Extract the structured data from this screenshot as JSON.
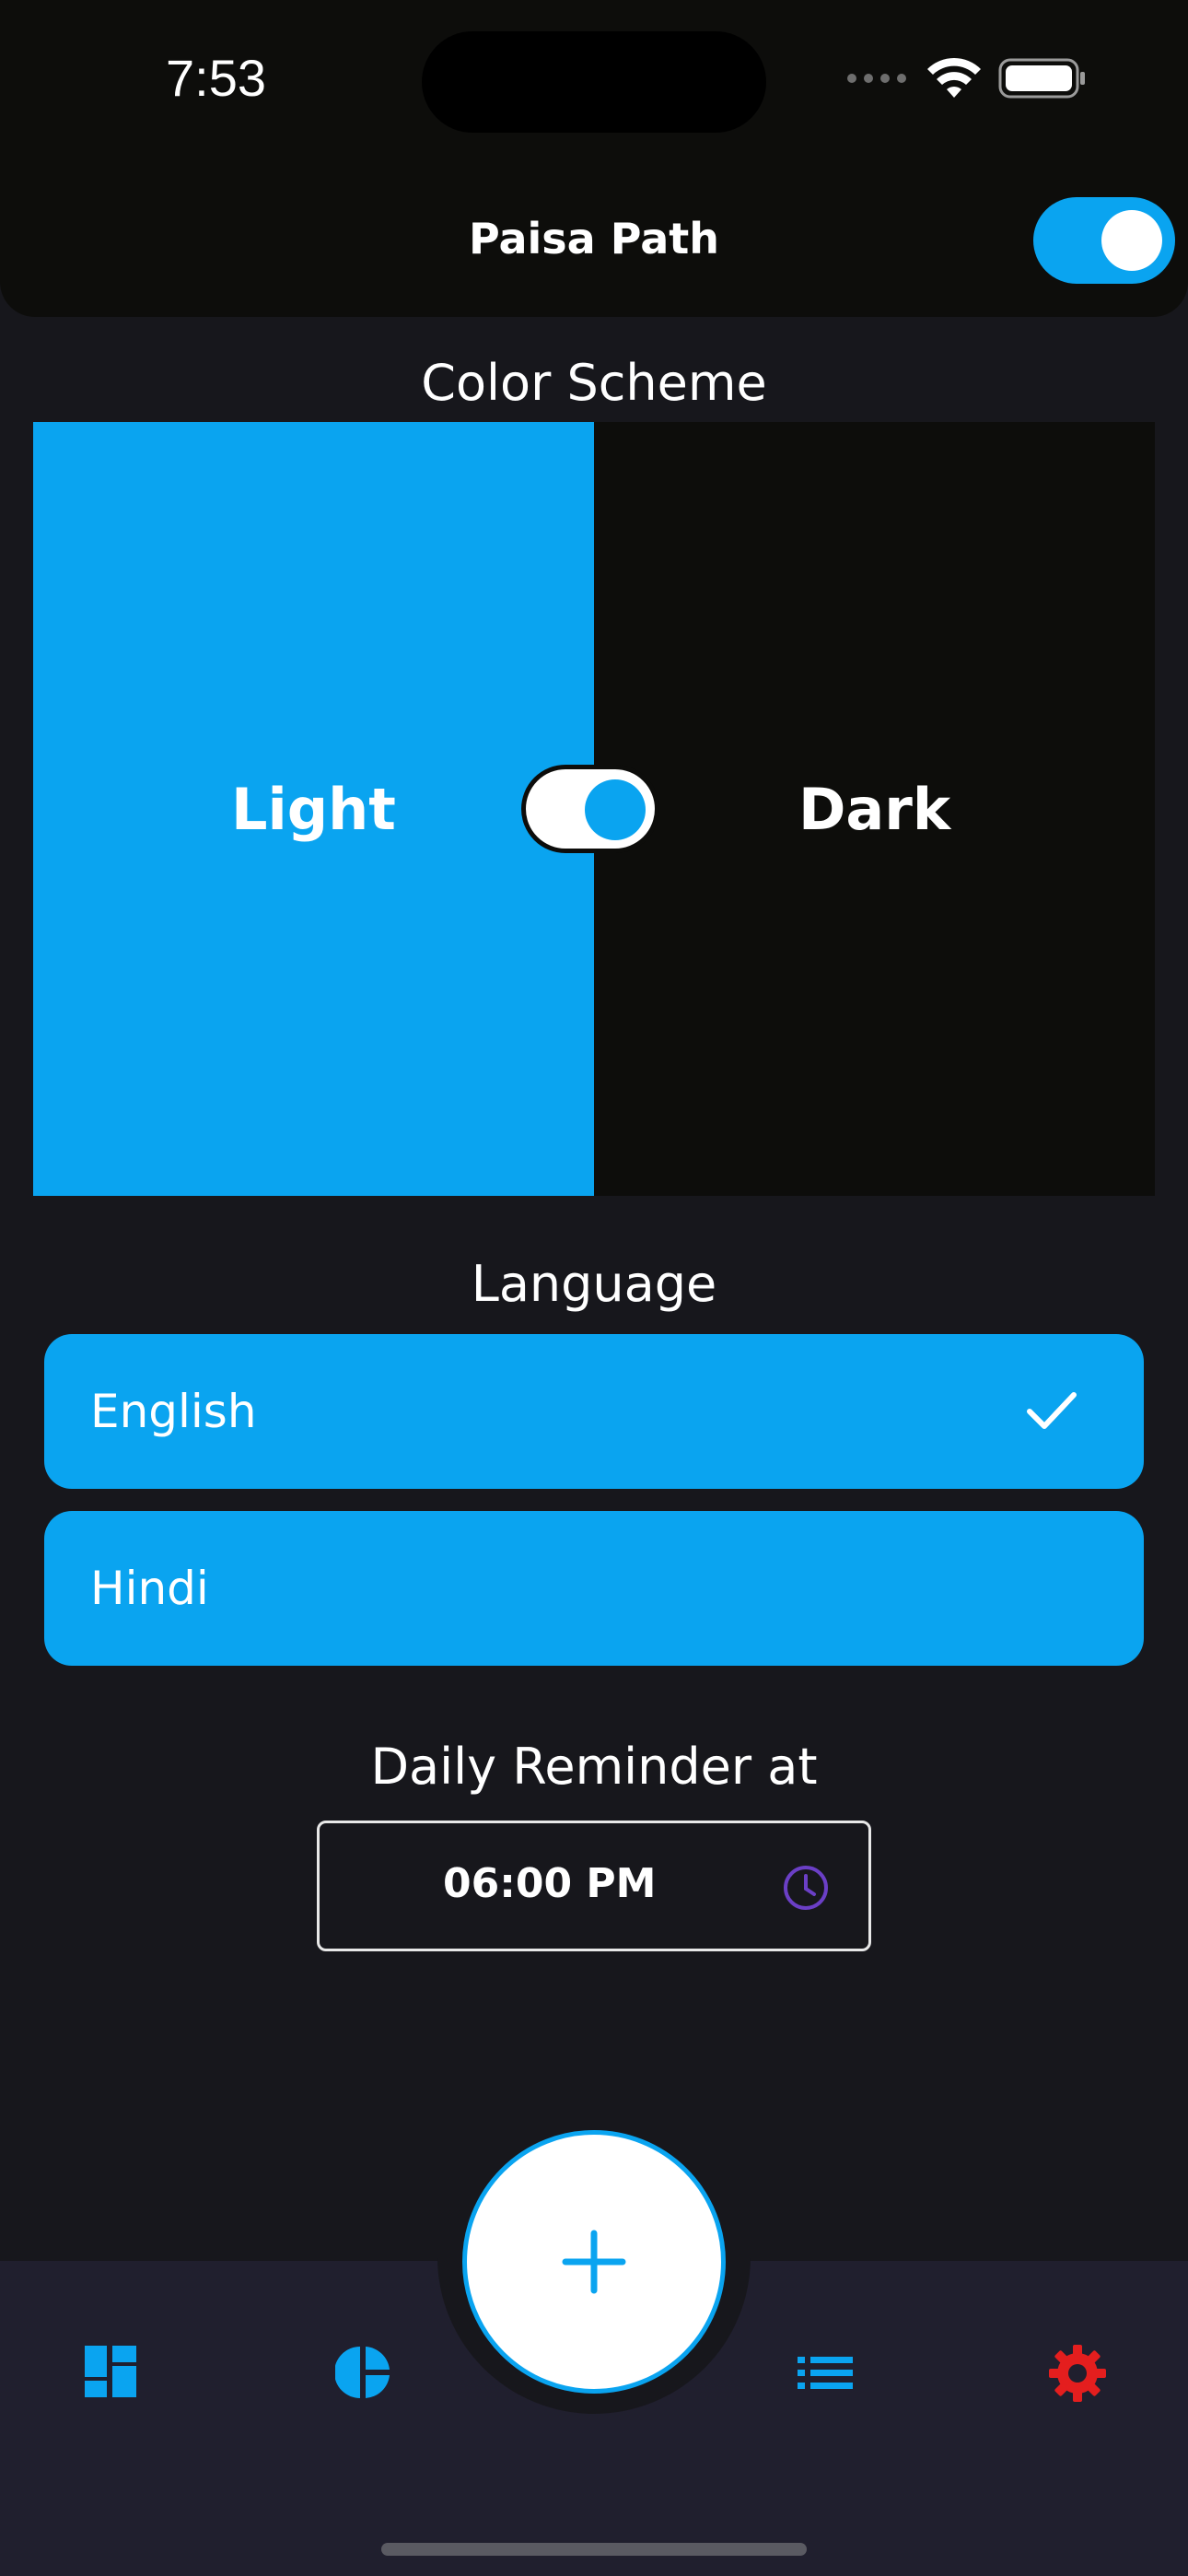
{
  "status_bar": {
    "time": "7:53"
  },
  "app_bar": {
    "title": "Paisa Path"
  },
  "color_scheme": {
    "title": "Color Scheme",
    "light_label": "Light",
    "dark_label": "Dark",
    "light_color": "#0aa4f0",
    "dark_color": "#0d0d0b"
  },
  "language": {
    "title": "Language",
    "options": [
      {
        "label": "English",
        "selected": true
      },
      {
        "label": "Hindi",
        "selected": false
      }
    ]
  },
  "reminder": {
    "title": "Daily Reminder at",
    "time": "06:00 PM"
  },
  "bottom_nav": {
    "items": [
      "dashboard-icon",
      "pie-chart-icon",
      "list-icon",
      "gear-icon"
    ],
    "accent": "#0aa4f0",
    "active_color": "#e41e1e"
  }
}
